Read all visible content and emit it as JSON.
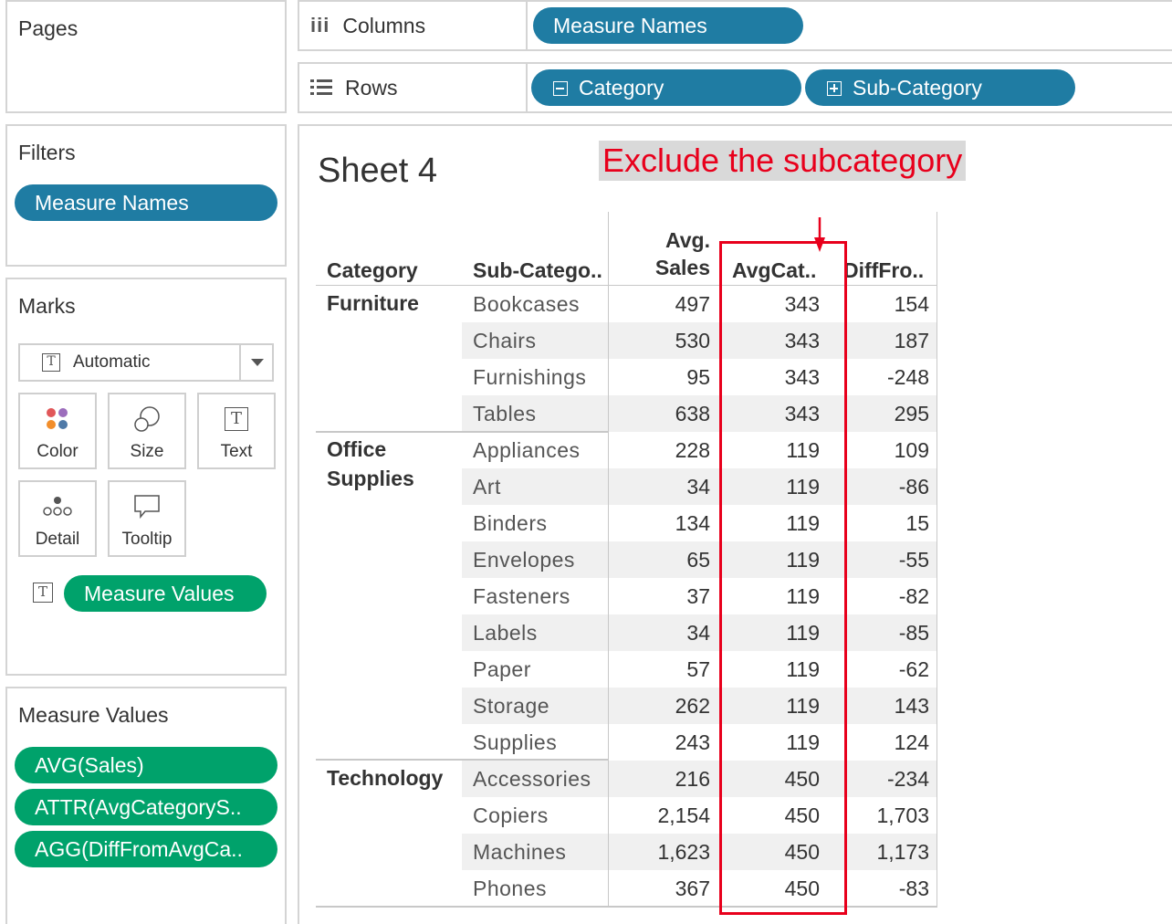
{
  "pages": {
    "title": "Pages"
  },
  "filters": {
    "title": "Filters",
    "pill": "Measure Names"
  },
  "marks": {
    "title": "Marks",
    "dropdown": "Automatic",
    "cards": {
      "color": "Color",
      "size": "Size",
      "text": "Text",
      "detail": "Detail",
      "tooltip": "Tooltip"
    },
    "text_pill": "Measure Values"
  },
  "measure_values": {
    "title": "Measure Values",
    "pills": [
      "AVG(Sales)",
      "ATTR(AvgCategoryS..",
      "AGG(DiffFromAvgCa.."
    ]
  },
  "shelves": {
    "columns_label": "Columns",
    "columns_pill": "Measure Names",
    "rows_label": "Rows",
    "rows_pills": [
      "Category",
      "Sub-Category"
    ]
  },
  "sheet": {
    "title": "Sheet 4",
    "annotation": "Exclude the subcategory",
    "headers": {
      "category": "Category",
      "subcategory": "Sub-Catego..",
      "avg_sales_1": "Avg.",
      "avg_sales_2": "Sales",
      "avgcat": "AvgCat..",
      "diff": "DiffFro.."
    },
    "categories": [
      "Furniture",
      "Office",
      "Supplies",
      "Technology"
    ],
    "rows": [
      {
        "sub": "Bookcases",
        "sales": "497",
        "avgcat": "343",
        "diff": "154"
      },
      {
        "sub": "Chairs",
        "sales": "530",
        "avgcat": "343",
        "diff": "187"
      },
      {
        "sub": "Furnishings",
        "sales": "95",
        "avgcat": "343",
        "diff": "-248"
      },
      {
        "sub": "Tables",
        "sales": "638",
        "avgcat": "343",
        "diff": "295"
      },
      {
        "sub": "Appliances",
        "sales": "228",
        "avgcat": "119",
        "diff": "109"
      },
      {
        "sub": "Art",
        "sales": "34",
        "avgcat": "119",
        "diff": "-86"
      },
      {
        "sub": "Binders",
        "sales": "134",
        "avgcat": "119",
        "diff": "15"
      },
      {
        "sub": "Envelopes",
        "sales": "65",
        "avgcat": "119",
        "diff": "-55"
      },
      {
        "sub": "Fasteners",
        "sales": "37",
        "avgcat": "119",
        "diff": "-82"
      },
      {
        "sub": "Labels",
        "sales": "34",
        "avgcat": "119",
        "diff": "-85"
      },
      {
        "sub": "Paper",
        "sales": "57",
        "avgcat": "119",
        "diff": "-62"
      },
      {
        "sub": "Storage",
        "sales": "262",
        "avgcat": "119",
        "diff": "143"
      },
      {
        "sub": "Supplies",
        "sales": "243",
        "avgcat": "119",
        "diff": "124"
      },
      {
        "sub": "Accessories",
        "sales": "216",
        "avgcat": "450",
        "diff": "-234"
      },
      {
        "sub": "Copiers",
        "sales": "2,154",
        "avgcat": "450",
        "diff": "1,703"
      },
      {
        "sub": "Machines",
        "sales": "1,623",
        "avgcat": "450",
        "diff": "1,173"
      },
      {
        "sub": "Phones",
        "sales": "367",
        "avgcat": "450",
        "diff": "-83"
      }
    ]
  },
  "colors": {
    "shelf_pill": "#1f7ca3",
    "measure_pill": "#00a26b",
    "annotation": "#e8001c"
  }
}
